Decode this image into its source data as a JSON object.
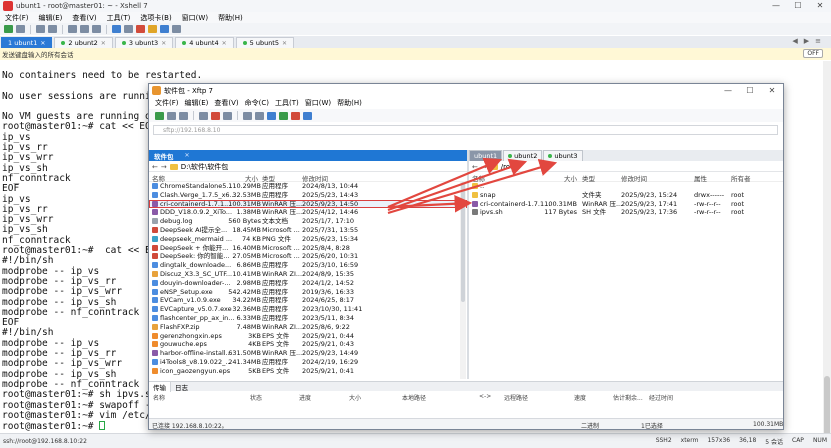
{
  "xshell": {
    "title": "ubunt1 - root@master01: ~ - Xshell 7",
    "menu": [
      "文件(F)",
      "编辑(E)",
      "查看(V)",
      "工具(T)",
      "选项卡(B)",
      "窗口(W)",
      "帮助(H)"
    ],
    "tabs": [
      {
        "label": "1 ubunt1",
        "active": true
      },
      {
        "label": "2 ubunt2"
      },
      {
        "label": "3 ubunt3"
      },
      {
        "label": "4 ubunt4"
      },
      {
        "label": "5 ubunt5"
      }
    ],
    "notice": "发送键盘输入的所有会话",
    "notice_toggle": "OFF",
    "terminal_lines": [
      "No containers need to be restarted.",
      "",
      "No user sessions are running",
      "",
      "No VM guests are running outd",
      "root@master01:~# cat << EOF |",
      "ip_vs",
      "ip_vs_rr",
      "ip_vs_wrr",
      "ip_vs_sh",
      "nf_conntrack",
      "EOF",
      "ip_vs",
      "ip_vs_rr",
      "ip_vs_wrr",
      "ip_vs_sh",
      "nf_conntrack",
      "root@master01:~#  cat << EOF",
      "#!/bin/sh",
      "modprobe -- ip_vs",
      "modprobe -- ip_vs_rr",
      "modprobe -- ip_vs_wrr",
      "modprobe -- ip_vs_sh",
      "modprobe -- nf_conntrack",
      "EOF",
      "#!/bin/sh",
      "modprobe -- ip_vs",
      "modprobe -- ip_vs_rr",
      "modprobe -- ip_vs_wrr",
      "modprobe -- ip_vs_sh",
      "modprobe -- nf_conntrack",
      "root@master01:~# sh ipvs.sh",
      "root@master01:~# swapoff -a",
      "root@master01:~# vim /etc/fst",
      "root@master01:~# "
    ],
    "status": {
      "left": "ssh://root@192.168.8.10:22",
      "ssh": "SSH2",
      "term": "xterm",
      "size": "157x36",
      "pos": "36,18",
      "sessions": "5 会话",
      "caps": "CAP",
      "num": "NUM"
    }
  },
  "xftp": {
    "title": "软件包 - Xftp 7",
    "menu": [
      "文件(F)",
      "编辑(E)",
      "查看(V)",
      "命令(C)",
      "工具(T)",
      "窗口(W)",
      "帮助(H)"
    ],
    "address": "sftp://192.168.8.10",
    "left_tab": "软件包",
    "right_tabs": [
      {
        "label": "ubunt1",
        "active": true
      },
      {
        "label": "ubunt2"
      },
      {
        "label": "ubunt3"
      }
    ],
    "left_path": "D:\\软件\\软件包",
    "right_path": "/root",
    "left_headers": [
      "名称",
      "大小",
      "类型",
      "修改时间"
    ],
    "right_headers": [
      "名称",
      "大小",
      "类型",
      "修改时间",
      "属性",
      "所有者"
    ],
    "left_files": [
      {
        "n": "ChromeStandalone5...",
        "s": "110.29MB",
        "t": "应用程序",
        "d": "2024/8/13, 10:44",
        "i": "exe"
      },
      {
        "n": "Clash.Verge_1.7.5_x6...",
        "s": "32.53MB",
        "t": "应用程序",
        "d": "2025/5/23, 14:43",
        "i": "exe"
      },
      {
        "n": "cri-containerd-1.7.1...",
        "s": "100.31MB",
        "t": "WinRAR 压...",
        "d": "2025/9/23, 14:50",
        "i": "rar",
        "sel": true
      },
      {
        "n": "DDD_V18.0.9.2_XiTo...",
        "s": "1.38MB",
        "t": "WinRAR 压...",
        "d": "2025/4/12, 14:46",
        "i": "rar"
      },
      {
        "n": "debug.log",
        "s": "560 Bytes",
        "t": "文本文档",
        "d": "2025/1/7, 17:10",
        "i": "txt"
      },
      {
        "n": "DeepSeek AI提示全...",
        "s": "18.45MB",
        "t": "Microsoft ...",
        "d": "2025/7/31, 13:55",
        "i": "pdf"
      },
      {
        "n": "deepseek_mermaid ...",
        "s": "74 KB",
        "t": "PNG 文件",
        "d": "2025/6/23, 15:34",
        "i": "png"
      },
      {
        "n": "DeepSeek + 你能开...",
        "s": "16.40MB",
        "t": "Microsoft ...",
        "d": "2025/8/4, 8:28",
        "i": "pdf"
      },
      {
        "n": "DeepSeek: 你的智能...",
        "s": "27.05MB",
        "t": "Microsoft ...",
        "d": "2025/6/20, 10:31",
        "i": "pdf"
      },
      {
        "n": "dingtalk_downloade...",
        "s": "6.86MB",
        "t": "应用程序",
        "d": "2025/3/10, 16:59",
        "i": "exe"
      },
      {
        "n": "Discuz_X3.3_SC_UTF...",
        "s": "10.41MB",
        "t": "WinRAR ZI...",
        "d": "2024/8/9, 15:35",
        "i": "zip"
      },
      {
        "n": "douyin-downloader-...",
        "s": "2.98MB",
        "t": "应用程序",
        "d": "2024/1/2, 14:52",
        "i": "exe"
      },
      {
        "n": "eNSP_Setup.exe",
        "s": "542.42MB",
        "t": "应用程序",
        "d": "2019/3/6, 16:33",
        "i": "exe"
      },
      {
        "n": "EVCam_v1.0.9.exe",
        "s": "34.22MB",
        "t": "应用程序",
        "d": "2024/6/25, 8:17",
        "i": "exe"
      },
      {
        "n": "EVCapture_v5.0.7.exe",
        "s": "32.36MB",
        "t": "应用程序",
        "d": "2023/10/30, 11:41",
        "i": "exe"
      },
      {
        "n": "flashcenter_pp_ax_in...",
        "s": "6.33MB",
        "t": "应用程序",
        "d": "2023/5/11, 8:34",
        "i": "exe"
      },
      {
        "n": "FlashFXP.zip",
        "s": "7.48MB",
        "t": "WinRAR ZI...",
        "d": "2025/8/6, 9:22",
        "i": "zip"
      },
      {
        "n": "gerenzhongxin.eps",
        "s": "3KB",
        "t": "EPS 文件",
        "d": "2025/9/21, 0:44",
        "i": "eps"
      },
      {
        "n": "gouwuche.eps",
        "s": "4KB",
        "t": "EPS 文件",
        "d": "2025/9/21, 0:43",
        "i": "eps"
      },
      {
        "n": "harbor-offline-install...",
        "s": "631.50MB",
        "t": "WinRAR 压...",
        "d": "2025/9/23, 14:49",
        "i": "rar"
      },
      {
        "n": "i4Tools8_v8.19.022_...",
        "s": "241.34MB",
        "t": "应用程序",
        "d": "2024/2/19, 16:29",
        "i": "exe"
      },
      {
        "n": "icon_gaozengyun.eps",
        "s": "5KB",
        "t": "EPS 文件",
        "d": "2025/9/21, 0:41",
        "i": "eps"
      }
    ],
    "right_files": [
      {
        "n": "..",
        "s": "",
        "t": "",
        "d": "",
        "a": "",
        "o": "",
        "i": "dir"
      },
      {
        "n": "snap",
        "s": "",
        "t": "文件夹",
        "d": "2025/9/23, 15:24",
        "a": "drwx------",
        "o": "root",
        "i": "dir"
      },
      {
        "n": "cri-containerd-1.7.1...",
        "s": "100.31MB",
        "t": "WinRAR 压...",
        "d": "2025/9/23, 17:41",
        "a": "-rw-r--r--",
        "o": "root",
        "i": "rar"
      },
      {
        "n": "ipvs.sh",
        "s": "117 Bytes",
        "t": "SH 文件",
        "d": "2025/9/23, 17:36",
        "a": "-rw-r--r--",
        "o": "root",
        "i": "sh"
      }
    ],
    "transfer_tabs": [
      "传输",
      "日志"
    ],
    "transfer_headers": [
      "名称",
      "状态",
      "进度",
      "大小",
      "本地路径",
      "<->",
      "远程路径",
      "速度",
      "估计剩余...",
      "经过时间"
    ],
    "status": {
      "left": "已连接 192.168.8.10:22。",
      "center": "二进制",
      "count": "1已选择",
      "size": "100.31MB"
    }
  }
}
